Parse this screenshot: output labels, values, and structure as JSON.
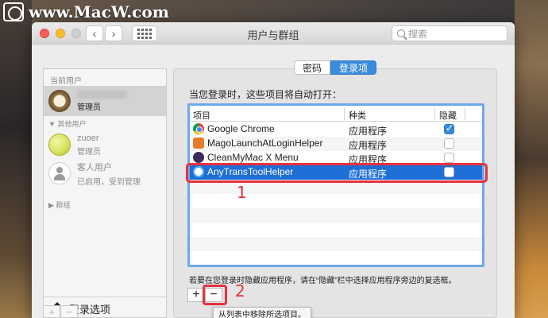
{
  "watermark": "www.MacW.com",
  "window": {
    "title": "用户与群组",
    "search_placeholder": "搜索"
  },
  "sidebar": {
    "current_users_label": "当前用户",
    "current_user_role": "管理员",
    "other_users_label": "其他用户",
    "other_user_name": "zuoer",
    "other_user_role": "管理员",
    "guest_name": "客人用户",
    "guest_status": "已启用，受到管理",
    "groups_label": "群组",
    "login_options": "登录选项",
    "add": "+",
    "remove": "−"
  },
  "tabs": [
    {
      "label": "密码",
      "active": false
    },
    {
      "label": "登录项",
      "active": true
    }
  ],
  "main": {
    "intro": "当您登录时，这些项目将自动打开：",
    "columns": [
      "项目",
      "种类",
      "隐藏"
    ],
    "rows": [
      {
        "name": "Google Chrome",
        "icon": "chrome-icon",
        "kind": "应用程序",
        "hidden": true
      },
      {
        "name": "MagoLaunchAtLoginHelper",
        "icon": "mago-icon",
        "kind": "应用程序",
        "hidden": false
      },
      {
        "name": "CleanMyMac X Menu",
        "icon": "cleanmymac-icon",
        "kind": "应用程序",
        "hidden": false
      },
      {
        "name": "AnyTransToolHelper",
        "icon": "anytrans-icon",
        "kind": "应用程序",
        "hidden": false,
        "selected": true
      }
    ],
    "hint": "若要在您登录时隐藏应用程序，请在“隐藏”栏中选择应用程序旁边的复选框。",
    "add": "+",
    "remove": "−",
    "tooltip": "从列表中移除所选项目。"
  },
  "annotations": {
    "one": "1",
    "two": "2",
    "color": "#e8313e"
  },
  "colors": {
    "accent": "#3b8bdc",
    "selection": "#1f6ed6"
  }
}
